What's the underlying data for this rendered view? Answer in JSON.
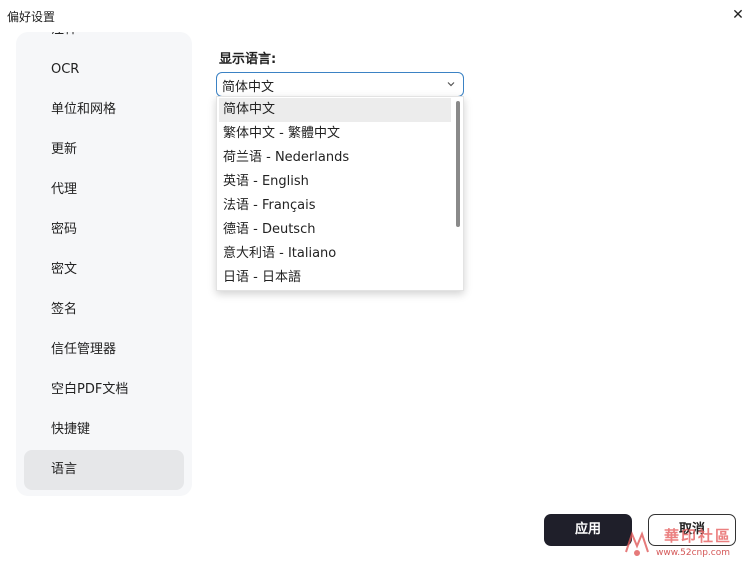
{
  "window": {
    "title": "偏好设置"
  },
  "sidebar": {
    "items": [
      {
        "label": "注释",
        "active": false
      },
      {
        "label": "OCR",
        "active": false
      },
      {
        "label": "单位和网格",
        "active": false
      },
      {
        "label": "更新",
        "active": false
      },
      {
        "label": "代理",
        "active": false
      },
      {
        "label": "密码",
        "active": false
      },
      {
        "label": "密文",
        "active": false
      },
      {
        "label": "签名",
        "active": false
      },
      {
        "label": "信任管理器",
        "active": false
      },
      {
        "label": "空白PDF文档",
        "active": false
      },
      {
        "label": "快捷键",
        "active": false
      },
      {
        "label": "语言",
        "active": true
      }
    ]
  },
  "language": {
    "label": "显示语言:",
    "selected": "简体中文",
    "options": [
      "简体中文",
      "繁体中文 - 繁體中文",
      "荷兰语 - Nederlands",
      "英语 - English",
      "法语 - Français",
      "德语 - Deutsch",
      "意大利语 - Italiano",
      "日语 - 日本語"
    ]
  },
  "footer": {
    "apply_label": "应用",
    "cancel_label": "取消"
  },
  "watermark": {
    "text": "華印社區",
    "sub": "www.52cnp.com"
  },
  "icons": {
    "close": "close-icon",
    "dropdown": "chevron-down-icon"
  },
  "colors": {
    "accent": "#3b82c4",
    "apply_bg": "#1f1f2a",
    "sidebar_bg": "#f6f7f9"
  }
}
